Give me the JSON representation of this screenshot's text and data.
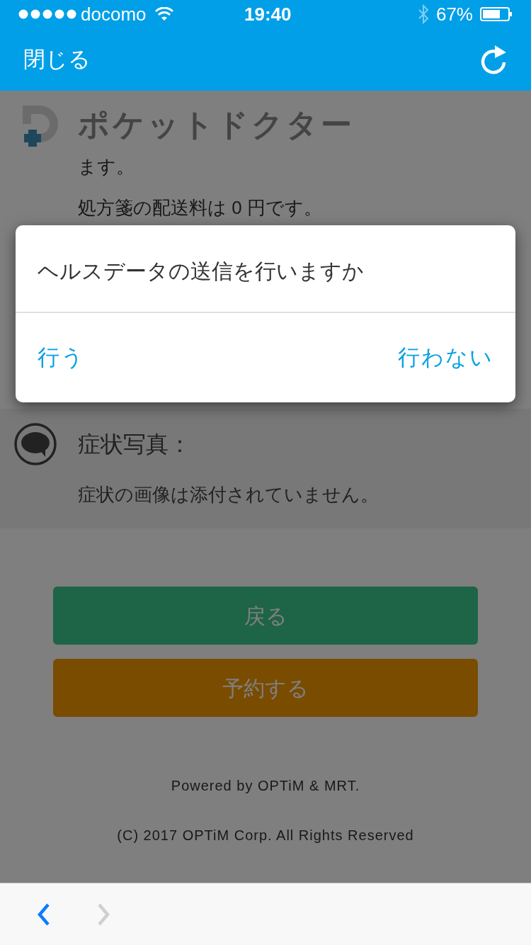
{
  "status_bar": {
    "carrier": "docomo",
    "time": "19:40",
    "battery": "67%"
  },
  "nav_bar": {
    "close": "閉じる"
  },
  "header": {
    "title": "ポケットドクター"
  },
  "content": {
    "lines": [
      "ます。",
      "処方箋の配送料は 0 円です。"
    ]
  },
  "photo_section": {
    "title": "症状写真：",
    "text": "症状の画像は添付されていません。"
  },
  "buttons": [
    {
      "label": "戻る",
      "kind": "back"
    },
    {
      "label": "予約する",
      "kind": "reserve"
    }
  ],
  "footer": [
    "Powered by OPTiM & MRT.",
    "(C) 2017 OPTiM Corp. All Rights Reserved"
  ],
  "dialog": {
    "message": "ヘルスデータの送信を行いますか",
    "actions": [
      "行う",
      "行わない"
    ]
  },
  "toolbar": {
    "back": {
      "disabled": false
    },
    "forward": {
      "disabled": true
    }
  }
}
